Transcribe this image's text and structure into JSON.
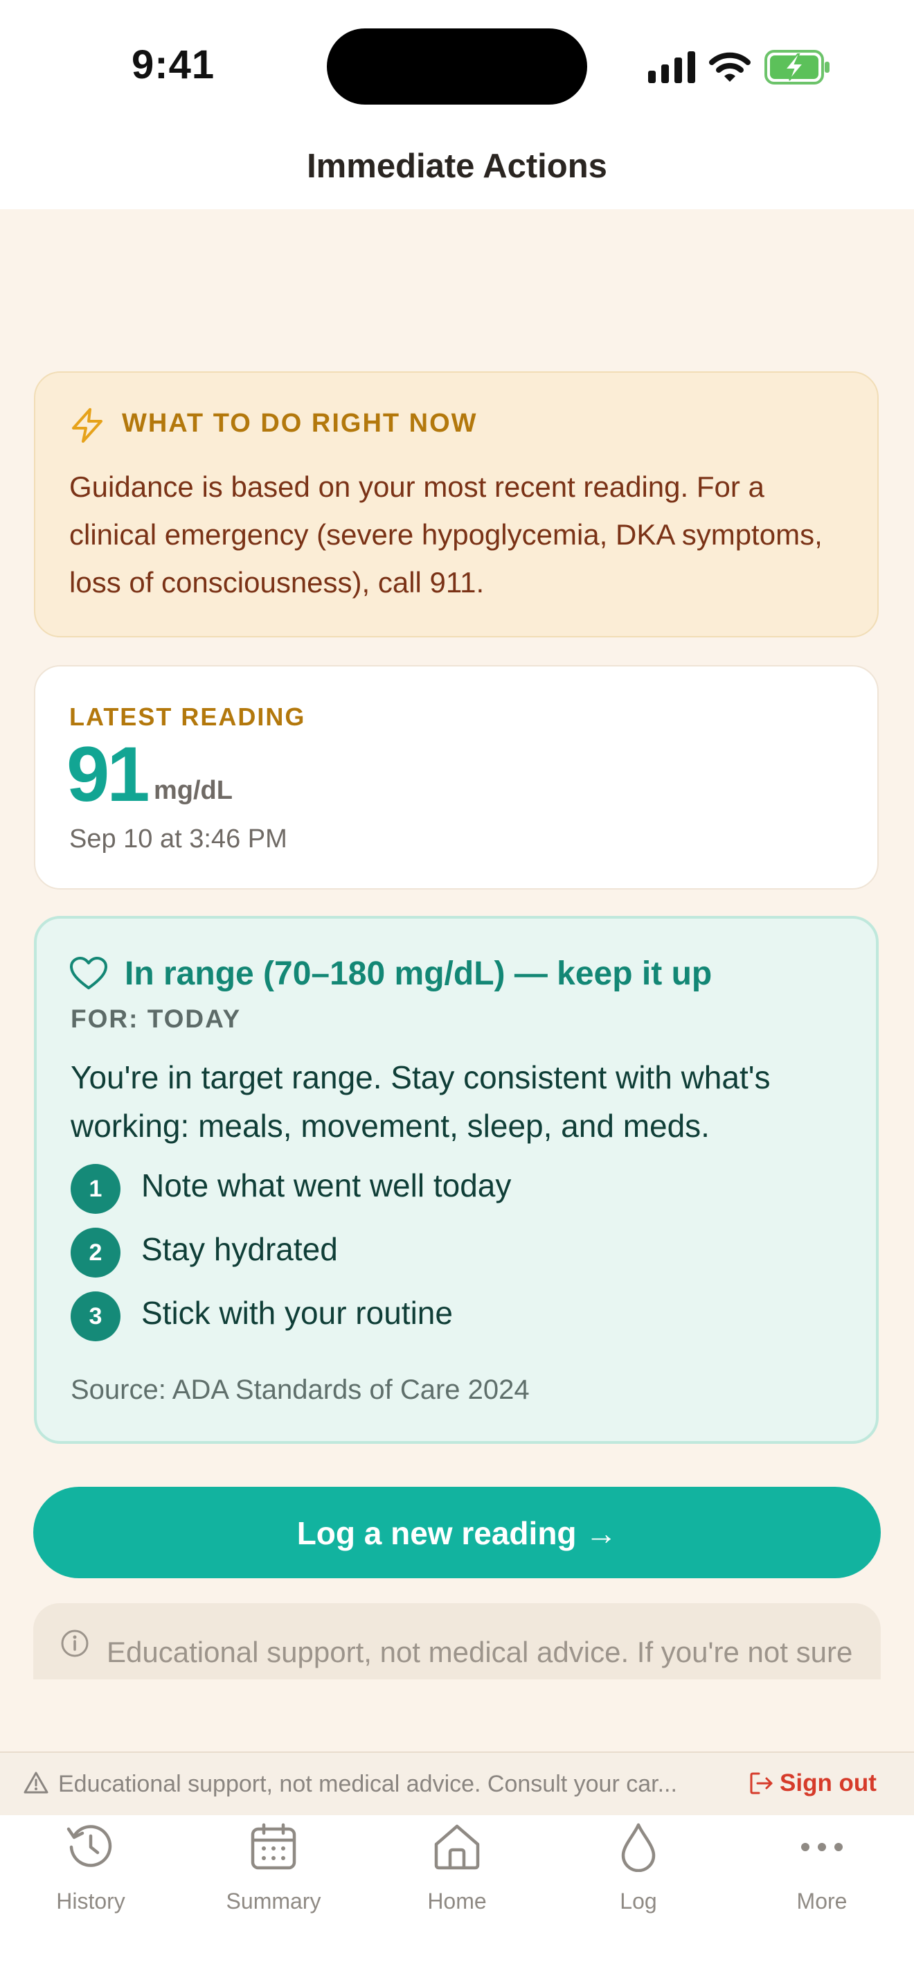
{
  "status_bar": {
    "time": "9:41"
  },
  "header": {
    "title": "Immediate Actions"
  },
  "alert_card": {
    "heading": "WHAT TO DO RIGHT NOW",
    "body": "Guidance is based on your most recent reading. For a clinical emergency (severe hypoglycemia, DKA symptoms, loss of consciousness), call 911."
  },
  "reading_card": {
    "label": "LATEST READING",
    "value": "91",
    "unit": "mg/dL",
    "timestamp": "Sep 10 at 3:46 PM"
  },
  "range_card": {
    "heading": "In range (70–180 mg/dL) — keep it up",
    "for_label": "FOR: TODAY",
    "body": "You're in target range. Stay consistent with what's working: meals, movement, sleep, and meds.",
    "steps": [
      {
        "number": "1",
        "text": "Note what went well today"
      },
      {
        "number": "2",
        "text": "Stay hydrated"
      },
      {
        "number": "3",
        "text": "Stick with your routine"
      }
    ],
    "source": "Source: ADA Standards of Care 2024"
  },
  "cta_button": {
    "label": "Log a new reading →"
  },
  "edu_card": {
    "text": "Educational support, not medical advice. If you're not sure what to do, call your care team."
  },
  "footer": {
    "disclaimer": "Educational support, not medical advice. Consult your car...",
    "sign_out": "Sign out"
  },
  "tabs": [
    {
      "label": "History",
      "icon": "history-icon"
    },
    {
      "label": "Summary",
      "icon": "calendar-icon"
    },
    {
      "label": "Home",
      "icon": "home-icon"
    },
    {
      "label": "Log",
      "icon": "drop-icon"
    },
    {
      "label": "More",
      "icon": "more-icon"
    }
  ],
  "colors": {
    "accent": "#12b39f",
    "warning_bg": "#fbedd6",
    "range_bg": "#e8f6f2",
    "danger": "#d63b2a"
  }
}
